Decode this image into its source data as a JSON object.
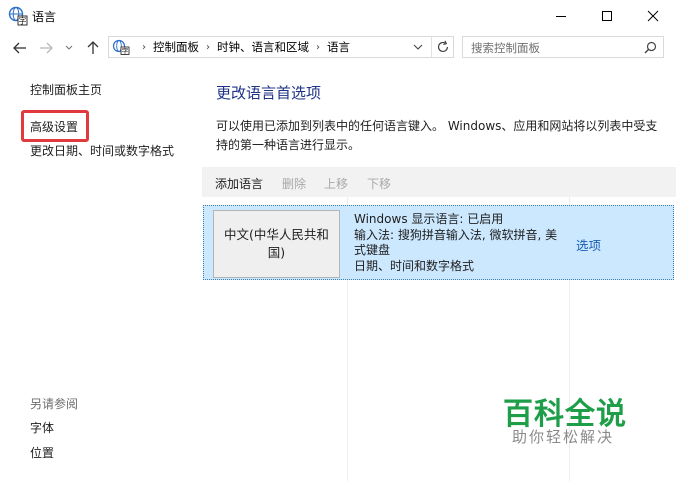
{
  "window": {
    "title": "语言",
    "minimize_glyph": "─",
    "maximize_glyph": "☐",
    "close_glyph": "✕"
  },
  "address": {
    "crumbs": [
      "控制面板",
      "时钟、语言和区域",
      "语言"
    ],
    "search_placeholder": "搜索控制面板",
    "icons": [
      "back-arrow-icon",
      "forward-arrow-icon",
      "recent-dropdown-icon",
      "up-arrow-icon",
      "control-panel-icon",
      "chevron-down-icon",
      "refresh-icon",
      "search-icon"
    ]
  },
  "sidebar": {
    "home": "控制面板主页",
    "advanced": "高级设置",
    "date_time": "更改日期、时间或数字格式",
    "see_also_header": "另请参阅",
    "fonts": "字体",
    "location": "位置"
  },
  "main": {
    "title": "更改语言首选项",
    "description": "可以使用已添加到列表中的任何语言键入。 Windows、应用和网站将以列表中受支持的第一种语言进行显示。",
    "toolbar": {
      "add": "添加语言",
      "remove": "删除",
      "up": "上移",
      "down": "下移"
    },
    "language": {
      "name": "中文(中华人民共和国)",
      "display_language": "Windows 显示语言: 已启用",
      "input_methods": "输入法: 搜狗拼音输入法, 微软拼音, 美式键盘",
      "date_time_format": "日期、时间和数字格式",
      "options": "选项"
    }
  },
  "watermark": {
    "main": "百科全说",
    "sub": "助你轻松解决"
  },
  "colors": {
    "title_blue": "#1e3287",
    "link_blue": "#1a5fb4",
    "selection": "#cce8ff",
    "highlight_red": "#e0393e",
    "watermark_green": "#1f9e4a"
  }
}
